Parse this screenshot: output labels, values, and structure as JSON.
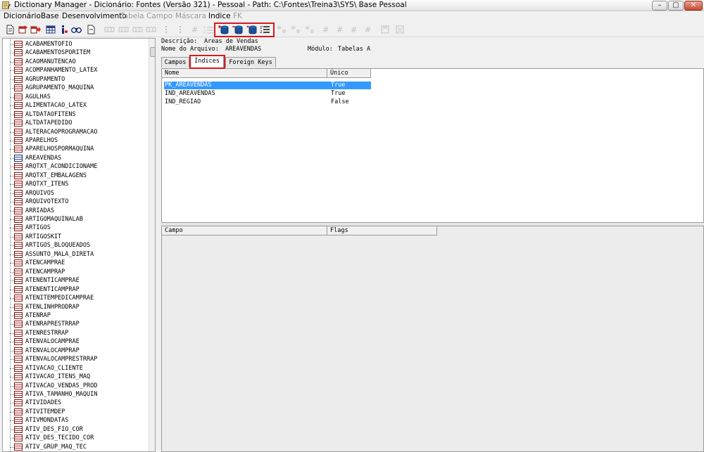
{
  "window": {
    "title": "Dictionary Manager - Dicionário: Fontes (Versão 321) - Pessoal - Path: C:\\Fontes\\Treina3\\SYS\\ Base Pessoal",
    "minimize": "–",
    "maximize": "▢",
    "close": "✕"
  },
  "menu": [
    {
      "label": "Dicionário",
      "enabled": true
    },
    {
      "label": "Base",
      "enabled": true
    },
    {
      "label": "Desenvolvimento",
      "enabled": true
    },
    {
      "label": "Tabela",
      "enabled": false
    },
    {
      "label": "Campo",
      "enabled": false
    },
    {
      "label": "Máscara",
      "enabled": false
    },
    {
      "label": "Indice",
      "enabled": true
    },
    {
      "label": "FK",
      "enabled": false
    }
  ],
  "toolbar": {
    "icons": [
      "new-document-icon",
      "open-red-icon",
      "arrow-right-red-icon",
      "grid-blue-icon",
      "info-icon",
      "binoculars-icon",
      "document-icon",
      "columns-icon",
      "columns-icon",
      "columns-icon",
      "columns-icon",
      "field-icon",
      "field-icon",
      "hash-icon",
      "numbered-list-icon",
      "add-index-icon",
      "delete-index-icon",
      "edit-index-icon",
      "index-fields-icon",
      "fk-icon",
      "fk-icon",
      "fk-icon",
      "hash-icon",
      "hash-icon",
      "hash-icon",
      "hash-icon",
      "save-icon",
      "export-icon"
    ],
    "highlight_color": "#d6191f"
  },
  "tree": {
    "selected": "AREAVENDAS",
    "items": [
      "ACABAMENTOFIO",
      "ACABAMENTOSPORITEM",
      "ACAOMANUTENCAO",
      "ACOMPANHAMENTO_LATEX",
      "AGRUPAMENTO",
      "AGRUPAMENTO_MAQUINA",
      "AGULHAS",
      "ALIMENTACAO_LATEX",
      "ALTDATAOFITENS",
      "ALTDATAPEDIDO",
      "ALTERACAOPROGRAMACAO",
      "APARELHOS",
      "APARELHOSPORMAQUINA",
      "AREAVENDAS",
      "ARQTXT_ACONDICIONAME",
      "ARQTXT_EMBALAGENS",
      "ARQTXT_ITENS",
      "ARQUIVOS",
      "ARQUIVOTEXTO",
      "ARRIADAS",
      "ARTIGOMAQUINALAB",
      "ARTIGOS",
      "ARTIGOSKIT",
      "ARTIGOS_BLOQUEADOS",
      "ASSUNTO_MALA_DIRETA",
      "ATENCAMPRAE",
      "ATENCAMPRAP",
      "ATENENTICAMPRAE",
      "ATENENTICAMPRAP",
      "ATENITEMPEDICAMPRAE",
      "ATENLINHPRODRAP",
      "ATENRAP",
      "ATENRAPRESTRRAP",
      "ATENRESTRRAP",
      "ATENVALOCAMPRAE",
      "ATENVALOCAMPRAP",
      "ATENVALOCAMPRESTRRAP",
      "ATIVACAO_CLIENTE",
      "ATIVACAO_ITENS_MAQ",
      "ATIVACAO_VENDAS_PROD",
      "ATIVA_TAMANHO_MAQUIN",
      "ATIVIDADES",
      "ATIVITEMDEP",
      "ATIVMONDATAS",
      "ATIV_DES_FIO_COR",
      "ATIV_DES_TECIDO_COR",
      "ATIV_GRUP_MAQ_TEC"
    ]
  },
  "details": {
    "descricao_label": "Descrição:",
    "descricao_value": "Areas de Vendas",
    "arquivo_label": "Nome do Arquivo:",
    "arquivo_value": "AREAVENDAS",
    "modulo_label": "Módulo:",
    "modulo_value": "Tabelas A"
  },
  "tabs": [
    {
      "label": "Campos",
      "active": false
    },
    {
      "label": "Índices",
      "active": true
    },
    {
      "label": "Foreign Keys",
      "active": false
    }
  ],
  "indices_grid": {
    "columns": [
      "Nome",
      "Único"
    ],
    "rows": [
      {
        "nome": "PK_AREAVENDAS",
        "unico": "True"
      },
      {
        "nome": "IND_AREAVENDAS",
        "unico": "True"
      },
      {
        "nome": "IND_REGIAO",
        "unico": "False"
      }
    ],
    "selected_row": 0,
    "selection_color": "#3399ff"
  },
  "fields_grid": {
    "columns": [
      "Campo",
      "Flags"
    ]
  }
}
